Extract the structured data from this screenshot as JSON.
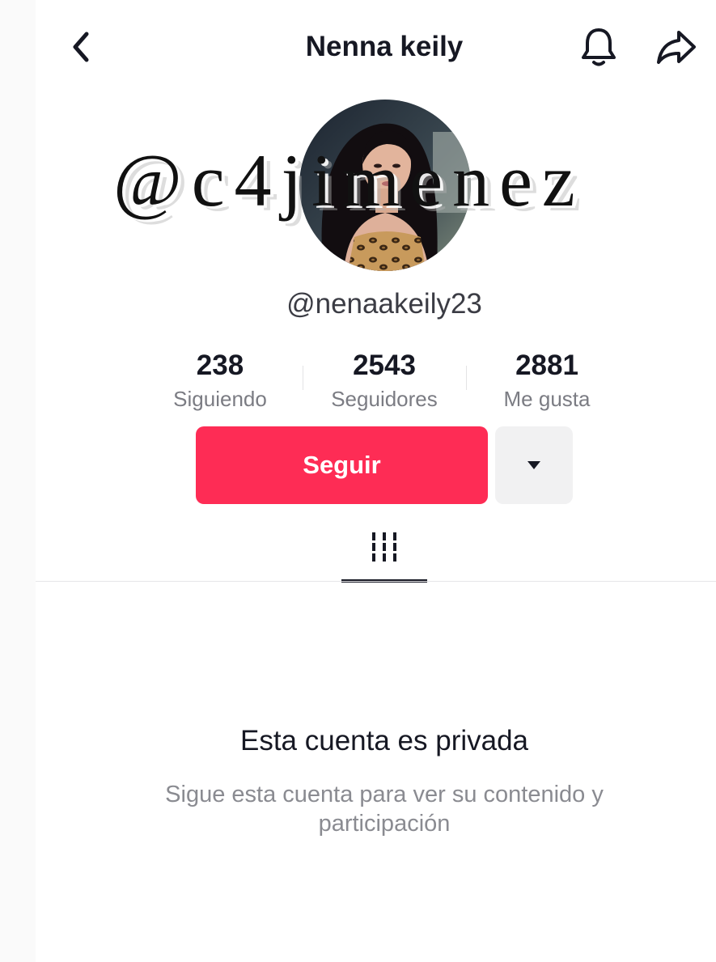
{
  "header": {
    "back_icon": "chevron-left-icon",
    "title": "Nenna keily",
    "bell_icon": "bell-icon",
    "share_icon": "share-arrow-icon"
  },
  "watermark": "@c4jimenez",
  "profile": {
    "username": "@nenaakeily23"
  },
  "stats": [
    {
      "value": "238",
      "label": "Siguiendo"
    },
    {
      "value": "2543",
      "label": "Seguidores"
    },
    {
      "value": "2881",
      "label": "Me gusta"
    }
  ],
  "actions": {
    "follow_label": "Seguir",
    "follow_color": "#fe2c55",
    "more_icon": "caret-down-icon"
  },
  "tabs": {
    "active_icon": "videos-grid-icon"
  },
  "private_notice": {
    "title": "Esta cuenta es privada",
    "description": "Sigue esta cuenta para ver su contenido y participación"
  }
}
